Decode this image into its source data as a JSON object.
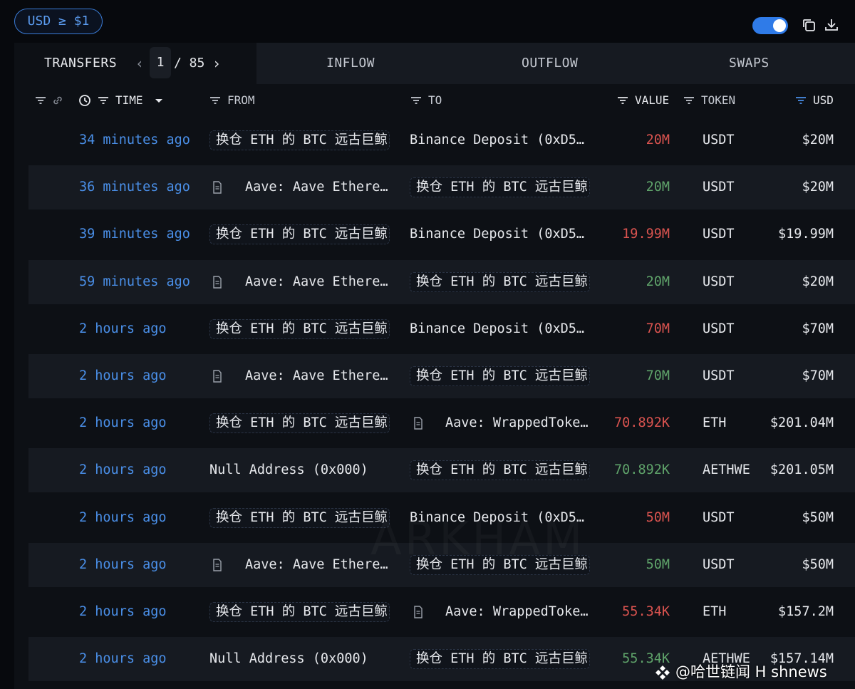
{
  "filter": {
    "label": "USD ≥ $1"
  },
  "tabs": {
    "transfers": "TRANSFERS",
    "page_current": "1",
    "page_total": "/ 85",
    "inflow": "INFLOW",
    "outflow": "OUTFLOW",
    "swaps": "SWAPS"
  },
  "columns": {
    "time": "TIME",
    "from": "FROM",
    "to": "TO",
    "value": "VALUE",
    "token": "TOKEN",
    "usd": "USD"
  },
  "rows": [
    {
      "time": "34 minutes ago",
      "from": "换仓 ETH 的 BTC 远古巨鲸",
      "from_entity": true,
      "from_doc": false,
      "to": "Binance Deposit (0xD5…",
      "to_entity": false,
      "to_doc": false,
      "value": "20M",
      "dir": "out",
      "token": "USDT",
      "usd": "$20M"
    },
    {
      "time": "36 minutes ago",
      "from": "Aave: Aave Ethere…",
      "from_entity": false,
      "from_doc": true,
      "to": "换仓 ETH 的 BTC 远古巨鲸",
      "to_entity": true,
      "to_doc": false,
      "value": "20M",
      "dir": "in",
      "token": "USDT",
      "usd": "$20M"
    },
    {
      "time": "39 minutes ago",
      "from": "换仓 ETH 的 BTC 远古巨鲸",
      "from_entity": true,
      "from_doc": false,
      "to": "Binance Deposit (0xD5…",
      "to_entity": false,
      "to_doc": false,
      "value": "19.99M",
      "dir": "out",
      "token": "USDT",
      "usd": "$19.99M"
    },
    {
      "time": "59 minutes ago",
      "from": "Aave: Aave Ethere…",
      "from_entity": false,
      "from_doc": true,
      "to": "换仓 ETH 的 BTC 远古巨鲸",
      "to_entity": true,
      "to_doc": false,
      "value": "20M",
      "dir": "in",
      "token": "USDT",
      "usd": "$20M"
    },
    {
      "time": "2 hours ago",
      "from": "换仓 ETH 的 BTC 远古巨鲸",
      "from_entity": true,
      "from_doc": false,
      "to": "Binance Deposit (0xD5…",
      "to_entity": false,
      "to_doc": false,
      "value": "70M",
      "dir": "out",
      "token": "USDT",
      "usd": "$70M"
    },
    {
      "time": "2 hours ago",
      "from": "Aave: Aave Ethere…",
      "from_entity": false,
      "from_doc": true,
      "to": "换仓 ETH 的 BTC 远古巨鲸",
      "to_entity": true,
      "to_doc": false,
      "value": "70M",
      "dir": "in",
      "token": "USDT",
      "usd": "$70M"
    },
    {
      "time": "2 hours ago",
      "from": "换仓 ETH 的 BTC 远古巨鲸",
      "from_entity": true,
      "from_doc": false,
      "to": "Aave: WrappedToke…",
      "to_entity": false,
      "to_doc": true,
      "value": "70.892K",
      "dir": "out",
      "token": "ETH",
      "usd": "$201.04M"
    },
    {
      "time": "2 hours ago",
      "from": "Null Address (0x000)",
      "from_entity": false,
      "from_doc": false,
      "to": "换仓 ETH 的 BTC 远古巨鲸",
      "to_entity": true,
      "to_doc": false,
      "value": "70.892K",
      "dir": "in",
      "token": "AETHWE",
      "usd": "$201.05M"
    },
    {
      "time": "2 hours ago",
      "from": "换仓 ETH 的 BTC 远古巨鲸",
      "from_entity": true,
      "from_doc": false,
      "to": "Binance Deposit (0xD5…",
      "to_entity": false,
      "to_doc": false,
      "value": "50M",
      "dir": "out",
      "token": "USDT",
      "usd": "$50M"
    },
    {
      "time": "2 hours ago",
      "from": "Aave: Aave Ethere…",
      "from_entity": false,
      "from_doc": true,
      "to": "换仓 ETH 的 BTC 远古巨鲸",
      "to_entity": true,
      "to_doc": false,
      "value": "50M",
      "dir": "in",
      "token": "USDT",
      "usd": "$50M"
    },
    {
      "time": "2 hours ago",
      "from": "换仓 ETH 的 BTC 远古巨鲸",
      "from_entity": true,
      "from_doc": false,
      "to": "Aave: WrappedToke…",
      "to_entity": false,
      "to_doc": true,
      "value": "55.34K",
      "dir": "out",
      "token": "ETH",
      "usd": "$157.2M"
    },
    {
      "time": "2 hours ago",
      "from": "Null Address (0x000)",
      "from_entity": false,
      "from_doc": false,
      "to": "换仓 ETH 的 BTC 远古巨鲸",
      "to_entity": true,
      "to_doc": false,
      "value": "55.34K",
      "dir": "in",
      "token": "AETHWE",
      "usd": "$157.14M"
    }
  ],
  "watermark": "ARKHAM",
  "credit": "@哈世链闻 H shnews",
  "colors": {
    "outflow": "#d9534f",
    "inflow": "#5fa36a",
    "link": "#4a8fe8",
    "accent": "#2f7be8"
  }
}
